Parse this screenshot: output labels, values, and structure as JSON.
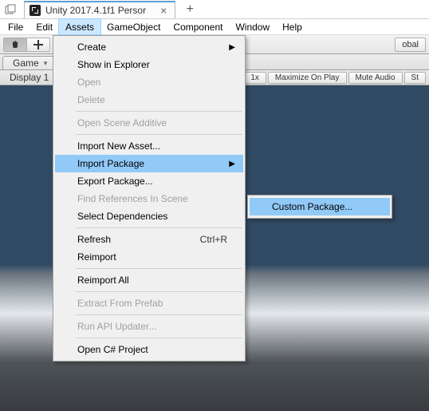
{
  "titlebar": {
    "app_title": "Unity 2017.4.1f1 Persor"
  },
  "menubar": {
    "items": [
      "File",
      "Edit",
      "Assets",
      "GameObject",
      "Component",
      "Window",
      "Help"
    ],
    "open_index": 2
  },
  "toolbar": {
    "right_chip": "obal"
  },
  "tabrow": {
    "game_label": "Game"
  },
  "optrow": {
    "display_label": "Display 1",
    "scale_label": "1x",
    "maximize_label": "Maximize On Play",
    "mute_label": "Mute Audio",
    "st_label": "St"
  },
  "assets_menu": {
    "create": "Create",
    "show_in_explorer": "Show in Explorer",
    "open": "Open",
    "delete": "Delete",
    "open_scene_additive": "Open Scene Additive",
    "import_new_asset": "Import New Asset...",
    "import_package": "Import Package",
    "export_package": "Export Package...",
    "find_references": "Find References In Scene",
    "select_dependencies": "Select Dependencies",
    "refresh": "Refresh",
    "refresh_shortcut": "Ctrl+R",
    "reimport": "Reimport",
    "reimport_all": "Reimport All",
    "extract_from_prefab": "Extract From Prefab",
    "run_api_updater": "Run API Updater...",
    "open_csharp": "Open C# Project"
  },
  "import_package_submenu": {
    "custom_package": "Custom Package..."
  }
}
